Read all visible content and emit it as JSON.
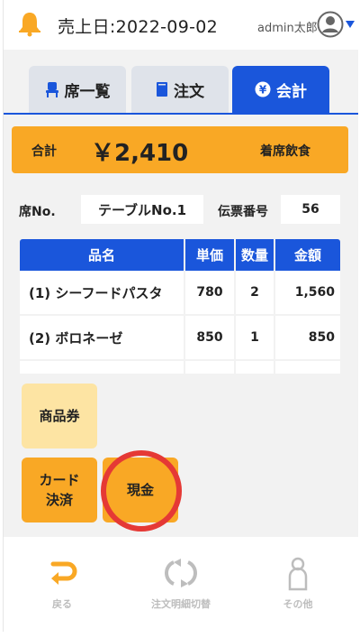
{
  "header": {
    "date_label": "売上日:2022-09-02",
    "user_name": "admin太郎",
    "bell_icon": "bell-icon",
    "avatar_icon": "user-avatar-icon",
    "caret_icon": "caret-down-icon"
  },
  "tabs": [
    {
      "label": "席一覧",
      "icon": "chair-icon",
      "active": false
    },
    {
      "label": "注文",
      "icon": "book-icon",
      "active": false
    },
    {
      "label": "会計",
      "icon": "yen-icon",
      "active": true
    }
  ],
  "total": {
    "label": "合計",
    "amount": "￥2,410",
    "dine_type": "着席飲食"
  },
  "seat": {
    "label": "席No.",
    "value": "テーブルNo.1",
    "slip_label": "伝票番号",
    "slip_value": "56"
  },
  "table": {
    "headers": [
      "品名",
      "単価",
      "数量",
      "金額"
    ],
    "rows": [
      {
        "name": "(1) シーフードパスタ",
        "price": "780",
        "qty": "2",
        "amount": "1,560"
      },
      {
        "name": "(2) ボロネーゼ",
        "price": "850",
        "qty": "1",
        "amount": "850"
      }
    ]
  },
  "payment_buttons": {
    "voucher": "商品券",
    "card_line1": "カード",
    "card_line2": "決済",
    "cash": "現金"
  },
  "bottom_nav": {
    "back": "戻る",
    "switch": "注文明細切替",
    "other": "その他"
  },
  "colors": {
    "accent_blue": "#1a56db",
    "accent_orange": "#f9a825",
    "light_orange": "#fde4a3",
    "highlight_red": "#e53935"
  }
}
